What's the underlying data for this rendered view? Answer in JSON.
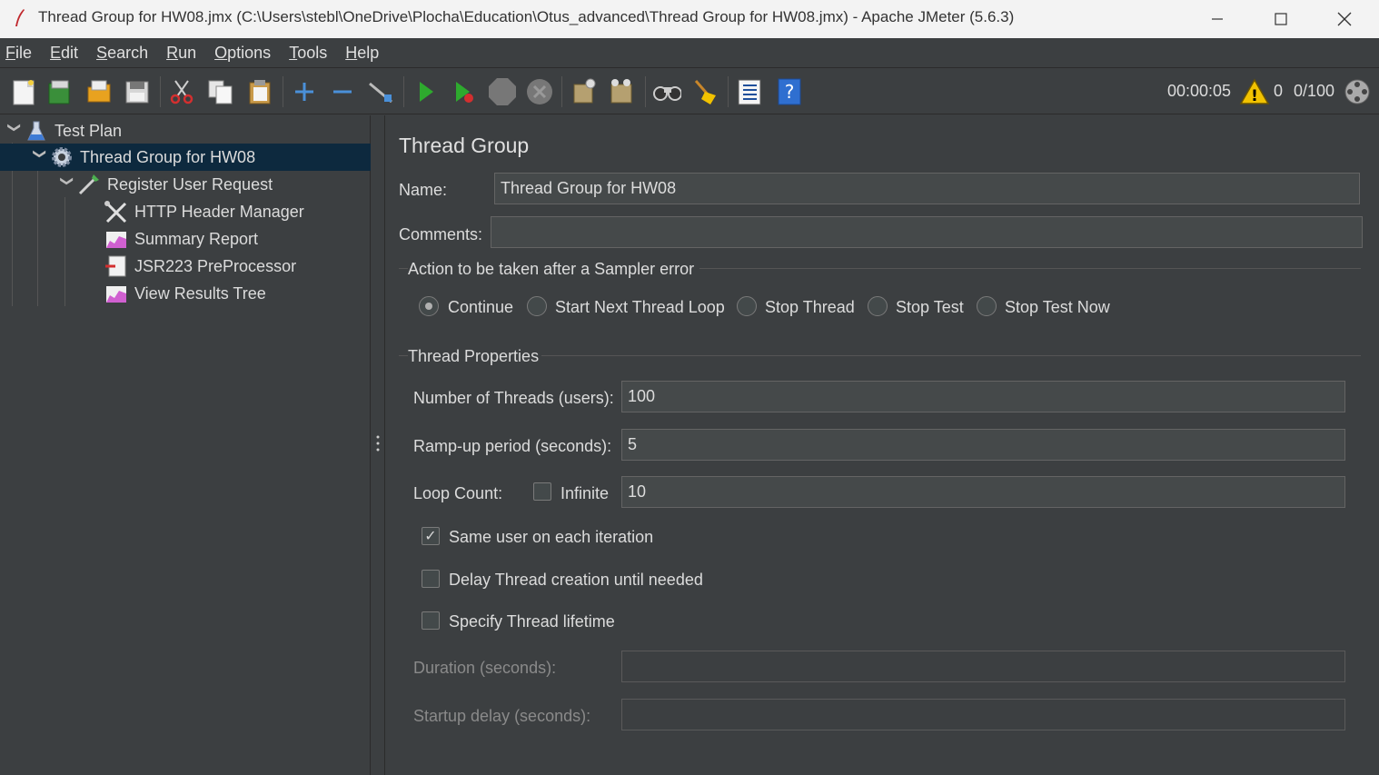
{
  "window": {
    "title": "Thread Group for HW08.jmx (C:\\Users\\stebl\\OneDrive\\Plocha\\Education\\Otus_advanced\\Thread Group for HW08.jmx) - Apache JMeter (5.6.3)",
    "minimize_icon": "minimize-icon",
    "maximize_icon": "maximize-icon",
    "close_icon": "close-icon"
  },
  "menu": [
    {
      "label": "File",
      "key": "F",
      "rest": "ile"
    },
    {
      "label": "Edit",
      "key": "E",
      "rest": "dit"
    },
    {
      "label": "Search",
      "key": "S",
      "rest": "earch"
    },
    {
      "label": "Run",
      "key": "R",
      "rest": "un"
    },
    {
      "label": "Options",
      "key": "O",
      "rest": "ptions"
    },
    {
      "label": "Tools",
      "key": "T",
      "rest": "ools"
    },
    {
      "label": "Help",
      "key": "H",
      "rest": "elp"
    }
  ],
  "toolbar": {
    "buttons": [
      "new-icon",
      "templates-icon",
      "open-icon",
      "save-icon",
      "cut-icon",
      "copy-icon",
      "paste-icon",
      "expand-icon",
      "collapse-icon",
      "toggle-icon",
      "start-icon",
      "start-no-pause-icon",
      "stop-icon",
      "shutdown-icon",
      "clear-icon",
      "clear-all-icon",
      "search-icon",
      "reset-search-icon",
      "function-helper-icon",
      "help-icon"
    ],
    "timer": "00:00:05",
    "warnings_count": "0",
    "threads": "0/100"
  },
  "tree": {
    "items": [
      {
        "label": "Test Plan",
        "icon": "test-plan-icon"
      },
      {
        "label": "Thread Group for HW08",
        "icon": "thread-group-icon"
      },
      {
        "label": "Register User Request",
        "icon": "sampler-icon"
      },
      {
        "label": "HTTP Header Manager",
        "icon": "header-manager-icon"
      },
      {
        "label": "Summary Report",
        "icon": "report-icon"
      },
      {
        "label": "JSR223 PreProcessor",
        "icon": "preprocessor-icon"
      },
      {
        "label": "View Results Tree",
        "icon": "report-icon"
      }
    ]
  },
  "main": {
    "title": "Thread Group",
    "name_label": "Name:",
    "name_value": "Thread Group for HW08",
    "comments_label": "Comments:",
    "comments_value": "",
    "error_action": {
      "title": "Action to be taken after a Sampler error",
      "options": [
        "Continue",
        "Start Next Thread Loop",
        "Stop Thread",
        "Stop Test",
        "Stop Test Now"
      ],
      "selected": "Continue"
    },
    "thread_props": {
      "title": "Thread Properties",
      "threads_label": "Number of Threads (users):",
      "threads_value": "100",
      "rampup_label": "Ramp-up period (seconds):",
      "rampup_value": "5",
      "loop_label": "Loop Count:",
      "infinite_label": "Infinite",
      "infinite_checked": false,
      "loop_value": "10",
      "same_user_label": "Same user on each iteration",
      "same_user_checked": true,
      "delay_label": "Delay Thread creation until needed",
      "delay_checked": false,
      "lifetime_label": "Specify Thread lifetime",
      "lifetime_checked": false,
      "duration_label": "Duration (seconds):",
      "duration_value": "",
      "startup_label": "Startup delay (seconds):",
      "startup_value": ""
    }
  }
}
